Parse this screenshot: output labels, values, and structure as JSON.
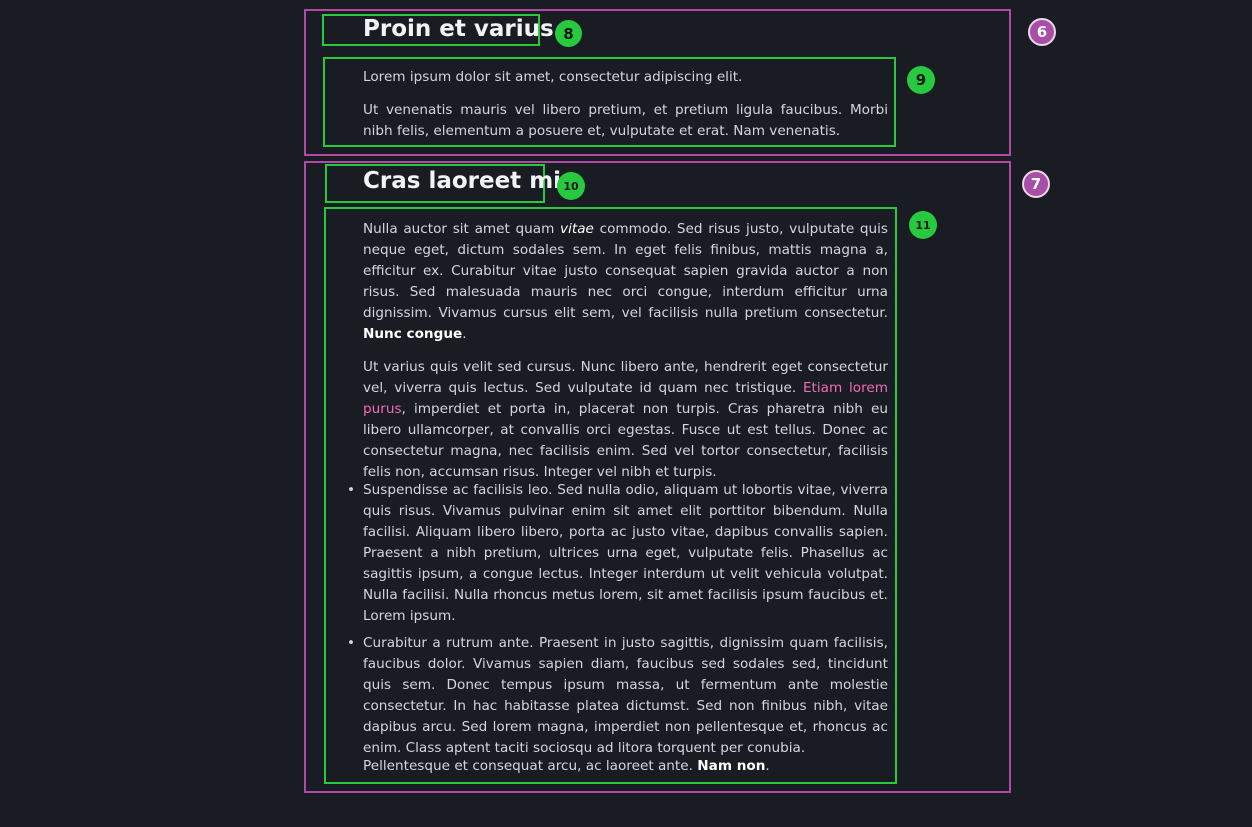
{
  "colors": {
    "background": "#1a1c24",
    "section_border": "#b04aa4",
    "element_border": "#27c93f",
    "link_accent": "#f06bbb"
  },
  "section_one": {
    "badge": "6",
    "heading": "Proin et varius",
    "heading_badge": "8",
    "content_badge": "9",
    "paragraphs": [
      "Lorem ipsum dolor sit amet, consectetur adipiscing elit.",
      "Ut venenatis mauris vel libero pretium, et pretium ligula faucibus. Morbi nibh felis, elementum a posuere et, vulputate et erat. Nam venenatis."
    ]
  },
  "section_two": {
    "badge": "7",
    "heading": "Cras laoreet mi",
    "heading_badge": "10",
    "content_badge": "11",
    "p1": {
      "before": "Nulla auctor sit amet quam ",
      "italic": "vitae",
      "middle": " commodo. Sed risus justo, vulputate quis neque eget, dictum sodales sem. In eget felis finibus, mattis magna a, efficitur ex. Curabitur vitae justo consequat sapien gravida auctor a non risus. Sed malesuada mauris nec orci congue, interdum efficitur urna dignissim. Vivamus cursus elit sem, vel facilisis nulla pretium consectetur. ",
      "bold": "Nunc congue",
      "after": "."
    },
    "p2": {
      "before": "Ut varius quis velit sed cursus. Nunc libero ante, hendrerit eget consectetur vel, viverra quis lectus. Sed vulputate id quam nec tristique. ",
      "link": "Etiam lorem purus",
      "after": ", imperdiet et porta in, placerat non turpis. Cras pharetra nibh eu libero ullamcorper, at convallis orci egestas. Fusce ut est tellus. Donec ac consectetur magna, nec facilisis enim. Sed vel tortor consectetur, facilisis felis non, accumsan risus. Integer vel nibh et turpis."
    },
    "list_items": [
      "Suspendisse ac facilisis leo. Sed nulla odio, aliquam ut lobortis vitae, viverra quis risus. Vivamus pulvinar enim sit amet elit porttitor bibendum. Nulla facilisi. Aliquam libero libero, porta ac justo vitae, dapibus convallis sapien. Praesent a nibh pretium, ultrices urna eget, vulputate felis. Phasellus ac sagittis ipsum, a congue lectus. Integer interdum ut velit vehicula volutpat. Nulla facilisi. Nulla rhoncus metus lorem, sit amet facilisis ipsum faucibus et. Lorem ipsum.",
      "Curabitur a rutrum ante. Praesent in justo sagittis, dignissim quam facilisis, faucibus dolor. Vivamus sapien diam, faucibus sed sodales sed, tincidunt quis sem. Donec tempus ipsum massa, ut fermentum ante molestie consectetur. In hac habitasse platea dictumst. Sed non finibus nibh, vitae dapibus arcu. Sed lorem magna, imperdiet non pellentesque et, rhoncus ac enim. Class aptent taciti sociosqu ad litora torquent per conubia."
    ],
    "bullet": "•",
    "p3": {
      "before": "Pellentesque et consequat arcu, ac laoreet ante. ",
      "bold": "Nam non",
      "after": "."
    }
  }
}
